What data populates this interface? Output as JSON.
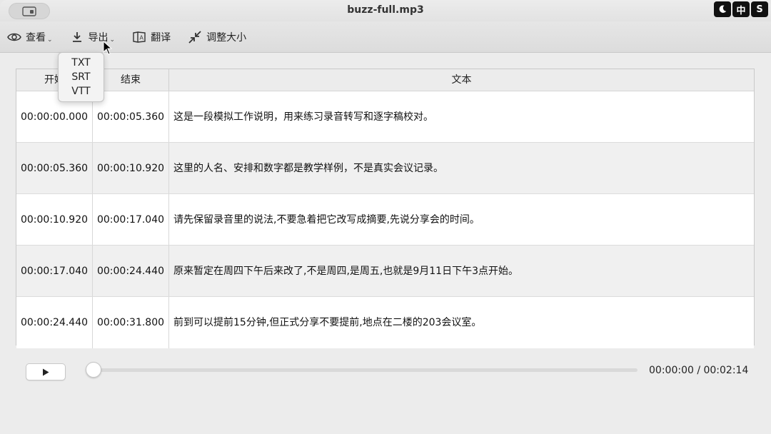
{
  "window": {
    "title": "buzz-full.mp3"
  },
  "tray": [
    "moon-icon",
    "中",
    "S"
  ],
  "toolbar": {
    "view_label": "查看",
    "export_label": "导出",
    "translate_label": "翻译",
    "resize_label": "调整大小"
  },
  "export_menu": {
    "items": [
      "TXT",
      "SRT",
      "VTT"
    ]
  },
  "table": {
    "headers": {
      "start": "开始",
      "end": "结束",
      "text": "文本"
    },
    "rows": [
      {
        "start": "00:00:00.000",
        "end": "00:00:05.360",
        "text": "这是一段模拟工作说明，用来练习录音转写和逐字稿校对。"
      },
      {
        "start": "00:00:05.360",
        "end": "00:00:10.920",
        "text": "这里的人名、安排和数字都是教学样例，不是真实会议记录。"
      },
      {
        "start": "00:00:10.920",
        "end": "00:00:17.040",
        "text": "请先保留录音里的说法,不要急着把它改写成摘要,先说分享会的时间。"
      },
      {
        "start": "00:00:17.040",
        "end": "00:00:24.440",
        "text": "原来暂定在周四下午后来改了,不是周四,是周五,也就是9月11日下午3点开始。"
      },
      {
        "start": "00:00:24.440",
        "end": "00:00:31.800",
        "text": "前到可以提前15分钟,但正式分享不要提前,地点在二楼的203会议室。"
      }
    ]
  },
  "player": {
    "position_fraction": 0.0,
    "time_display": "00:00:00 / 00:02:14"
  },
  "colors": {
    "accent": "#3a82f7",
    "tray_bg": "#111111"
  }
}
